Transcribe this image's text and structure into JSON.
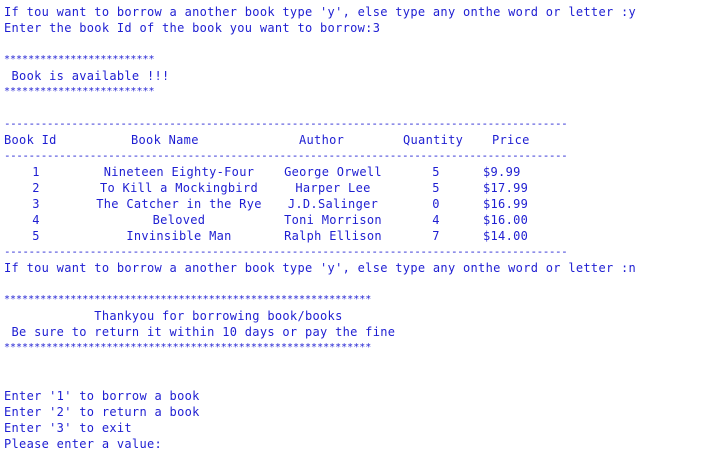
{
  "console": {
    "prompt_borrow_another_1": "If tou want to borrow a another book type 'y', else type any onthe word or letter :y",
    "prompt_book_id": "Enter the book Id of the book you want to borrow:3",
    "stars_short": "*************************",
    "available_message": " Book is available !!!",
    "dashes_table": "--------------------------------------------------------------------------------------------",
    "table": {
      "headers": {
        "id": "Book Id",
        "name": "Book Name",
        "author": "Author",
        "quantity": "Quantity",
        "price": "Price"
      },
      "rows": [
        {
          "id": "1",
          "name": "Nineteen Eighty-Four",
          "author": "George Orwell",
          "quantity": "5",
          "price": "$9.99"
        },
        {
          "id": "2",
          "name": "To Kill a Mockingbird",
          "author": "Harper Lee",
          "quantity": "5",
          "price": "$17.99"
        },
        {
          "id": "3",
          "name": "The Catcher in the Rye",
          "author": "J.D.Salinger",
          "quantity": "0",
          "price": "$16.99"
        },
        {
          "id": "4",
          "name": "Beloved",
          "author": "Toni Morrison",
          "quantity": "4",
          "price": "$16.00"
        },
        {
          "id": "5",
          "name": "Invinsible Man",
          "author": "Ralph Ellison",
          "quantity": "7",
          "price": "$14.00"
        }
      ]
    },
    "prompt_borrow_another_2": "If tou want to borrow a another book type 'y', else type any onthe word or letter :n",
    "stars_long": "*************************************************************",
    "thankyou_message": "            Thankyou for borrowing book/books",
    "return_reminder": " Be sure to return it within 10 days or pay the fine",
    "menu": {
      "option_1": "Enter '1' to borrow a book",
      "option_2": "Enter '2' to return a book",
      "option_3": "Enter '3' to exit",
      "input_prompt": "Please enter a value:"
    }
  },
  "colors": {
    "text": "#1e1ed2",
    "background": "#ffffff"
  }
}
